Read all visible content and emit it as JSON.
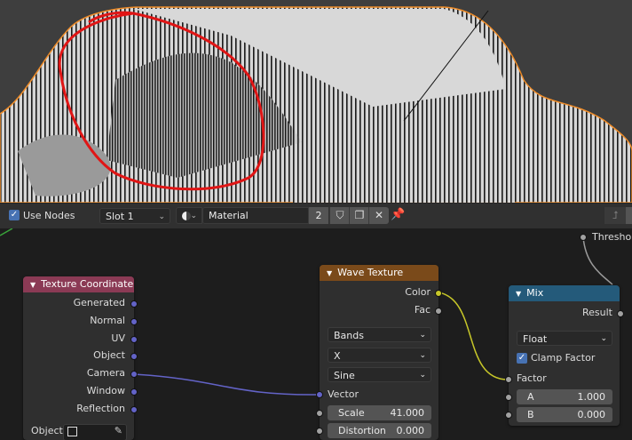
{
  "toolbar": {
    "use_nodes_label": "Use Nodes",
    "slot_value": "Slot 1",
    "material_name": "Material",
    "user_count": "2"
  },
  "nodes": {
    "texture_coordinate": {
      "title": "Texture Coordinate",
      "outputs": [
        "Generated",
        "Normal",
        "UV",
        "Object",
        "Camera",
        "Window",
        "Reflection"
      ],
      "object_label": "Object:"
    },
    "wave_texture": {
      "title": "Wave Texture",
      "outputs": [
        "Color",
        "Fac"
      ],
      "type_value": "Bands",
      "direction_value": "X",
      "profile_value": "Sine",
      "vector_label": "Vector",
      "scale_label": "Scale",
      "scale_value": "41.000",
      "distortion_label": "Distortion",
      "distortion_value": "0.000"
    },
    "mix": {
      "title": "Mix",
      "result_label": "Result",
      "data_type_value": "Float",
      "clamp_label": "Clamp Factor",
      "factor_label": "Factor",
      "a_label": "A",
      "a_value": "1.000",
      "b_label": "B",
      "b_value": "0.000"
    },
    "threshold_label": "Threshold"
  },
  "colors": {
    "tex_coord_header": "#8b3a55",
    "wave_header": "#7a4a1a",
    "mix_header": "#245a7a",
    "vector_socket": "#6363c7",
    "color_socket": "#c7c729",
    "float_socket": "#a1a1a1",
    "annotation": "#e01515",
    "selection_outline": "#f08d29"
  }
}
